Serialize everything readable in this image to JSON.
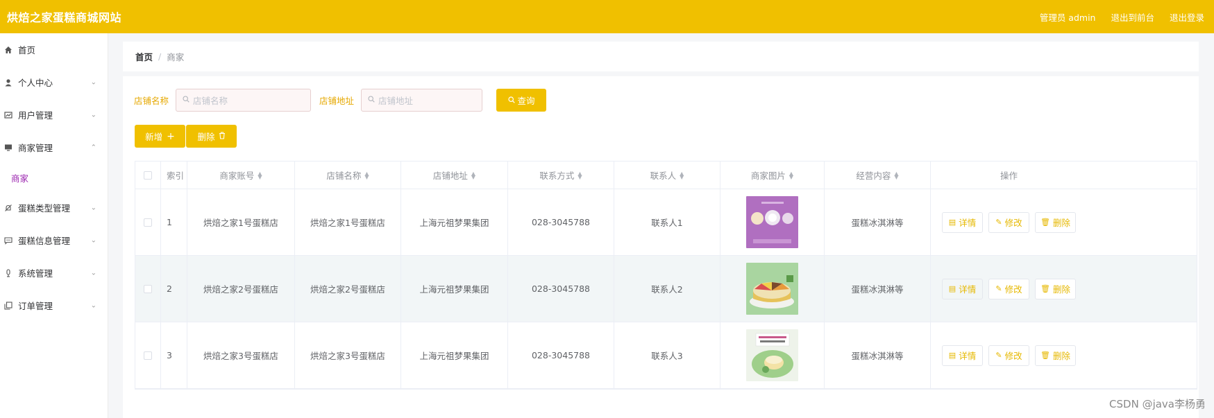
{
  "header": {
    "title": "烘焙之家蛋糕商城网站",
    "admin_label": "管理员 admin",
    "to_front_label": "退出到前台",
    "logout_label": "退出登录"
  },
  "sidebar": {
    "items": [
      {
        "label": "首页",
        "icon": "home-icon"
      },
      {
        "label": "个人中心",
        "icon": "user-icon"
      },
      {
        "label": "用户管理",
        "icon": "chart-icon"
      },
      {
        "label": "商家管理",
        "icon": "monitor-icon"
      },
      {
        "label": "商家",
        "icon": ""
      },
      {
        "label": "蛋糕类型管理",
        "icon": "bell-off-icon"
      },
      {
        "label": "蛋糕信息管理",
        "icon": "message-icon"
      },
      {
        "label": "系统管理",
        "icon": "mic-icon"
      },
      {
        "label": "订单管理",
        "icon": "copy-icon"
      }
    ]
  },
  "breadcrumb": {
    "home": "首页",
    "separator": "/",
    "current": "商家"
  },
  "search": {
    "name_label": "店铺名称",
    "name_placeholder": "店铺名称",
    "addr_label": "店铺地址",
    "addr_placeholder": "店铺地址",
    "query_label": "查询"
  },
  "actions": {
    "add_label": "新增",
    "delete_label": "删除"
  },
  "table": {
    "headers": {
      "index": "索引",
      "account": "商家账号",
      "name": "店铺名称",
      "address": "店铺地址",
      "phone": "联系方式",
      "contact": "联系人",
      "image": "商家图片",
      "business": "经营内容",
      "ops": "操作"
    },
    "rows": [
      {
        "index": "1",
        "account": "烘焙之家1号蛋糕店",
        "name": "烘焙之家1号蛋糕店",
        "address": "上海元祖梦果集团",
        "phone": "028-3045788",
        "contact": "联系人1",
        "business": "蛋糕冰淇淋等"
      },
      {
        "index": "2",
        "account": "烘焙之家2号蛋糕店",
        "name": "烘焙之家2号蛋糕店",
        "address": "上海元祖梦果集团",
        "phone": "028-3045788",
        "contact": "联系人2",
        "business": "蛋糕冰淇淋等"
      },
      {
        "index": "3",
        "account": "烘焙之家3号蛋糕店",
        "name": "烘焙之家3号蛋糕店",
        "address": "上海元祖梦果集团",
        "phone": "028-3045788",
        "contact": "联系人3",
        "business": "蛋糕冰淇淋等"
      }
    ],
    "op_labels": {
      "detail": "详情",
      "edit": "修改",
      "delete": "删除"
    }
  },
  "watermark": "CSDN @java李杨勇",
  "colors": {
    "accent": "#f0c000",
    "submenu_active": "#9c27b0"
  }
}
